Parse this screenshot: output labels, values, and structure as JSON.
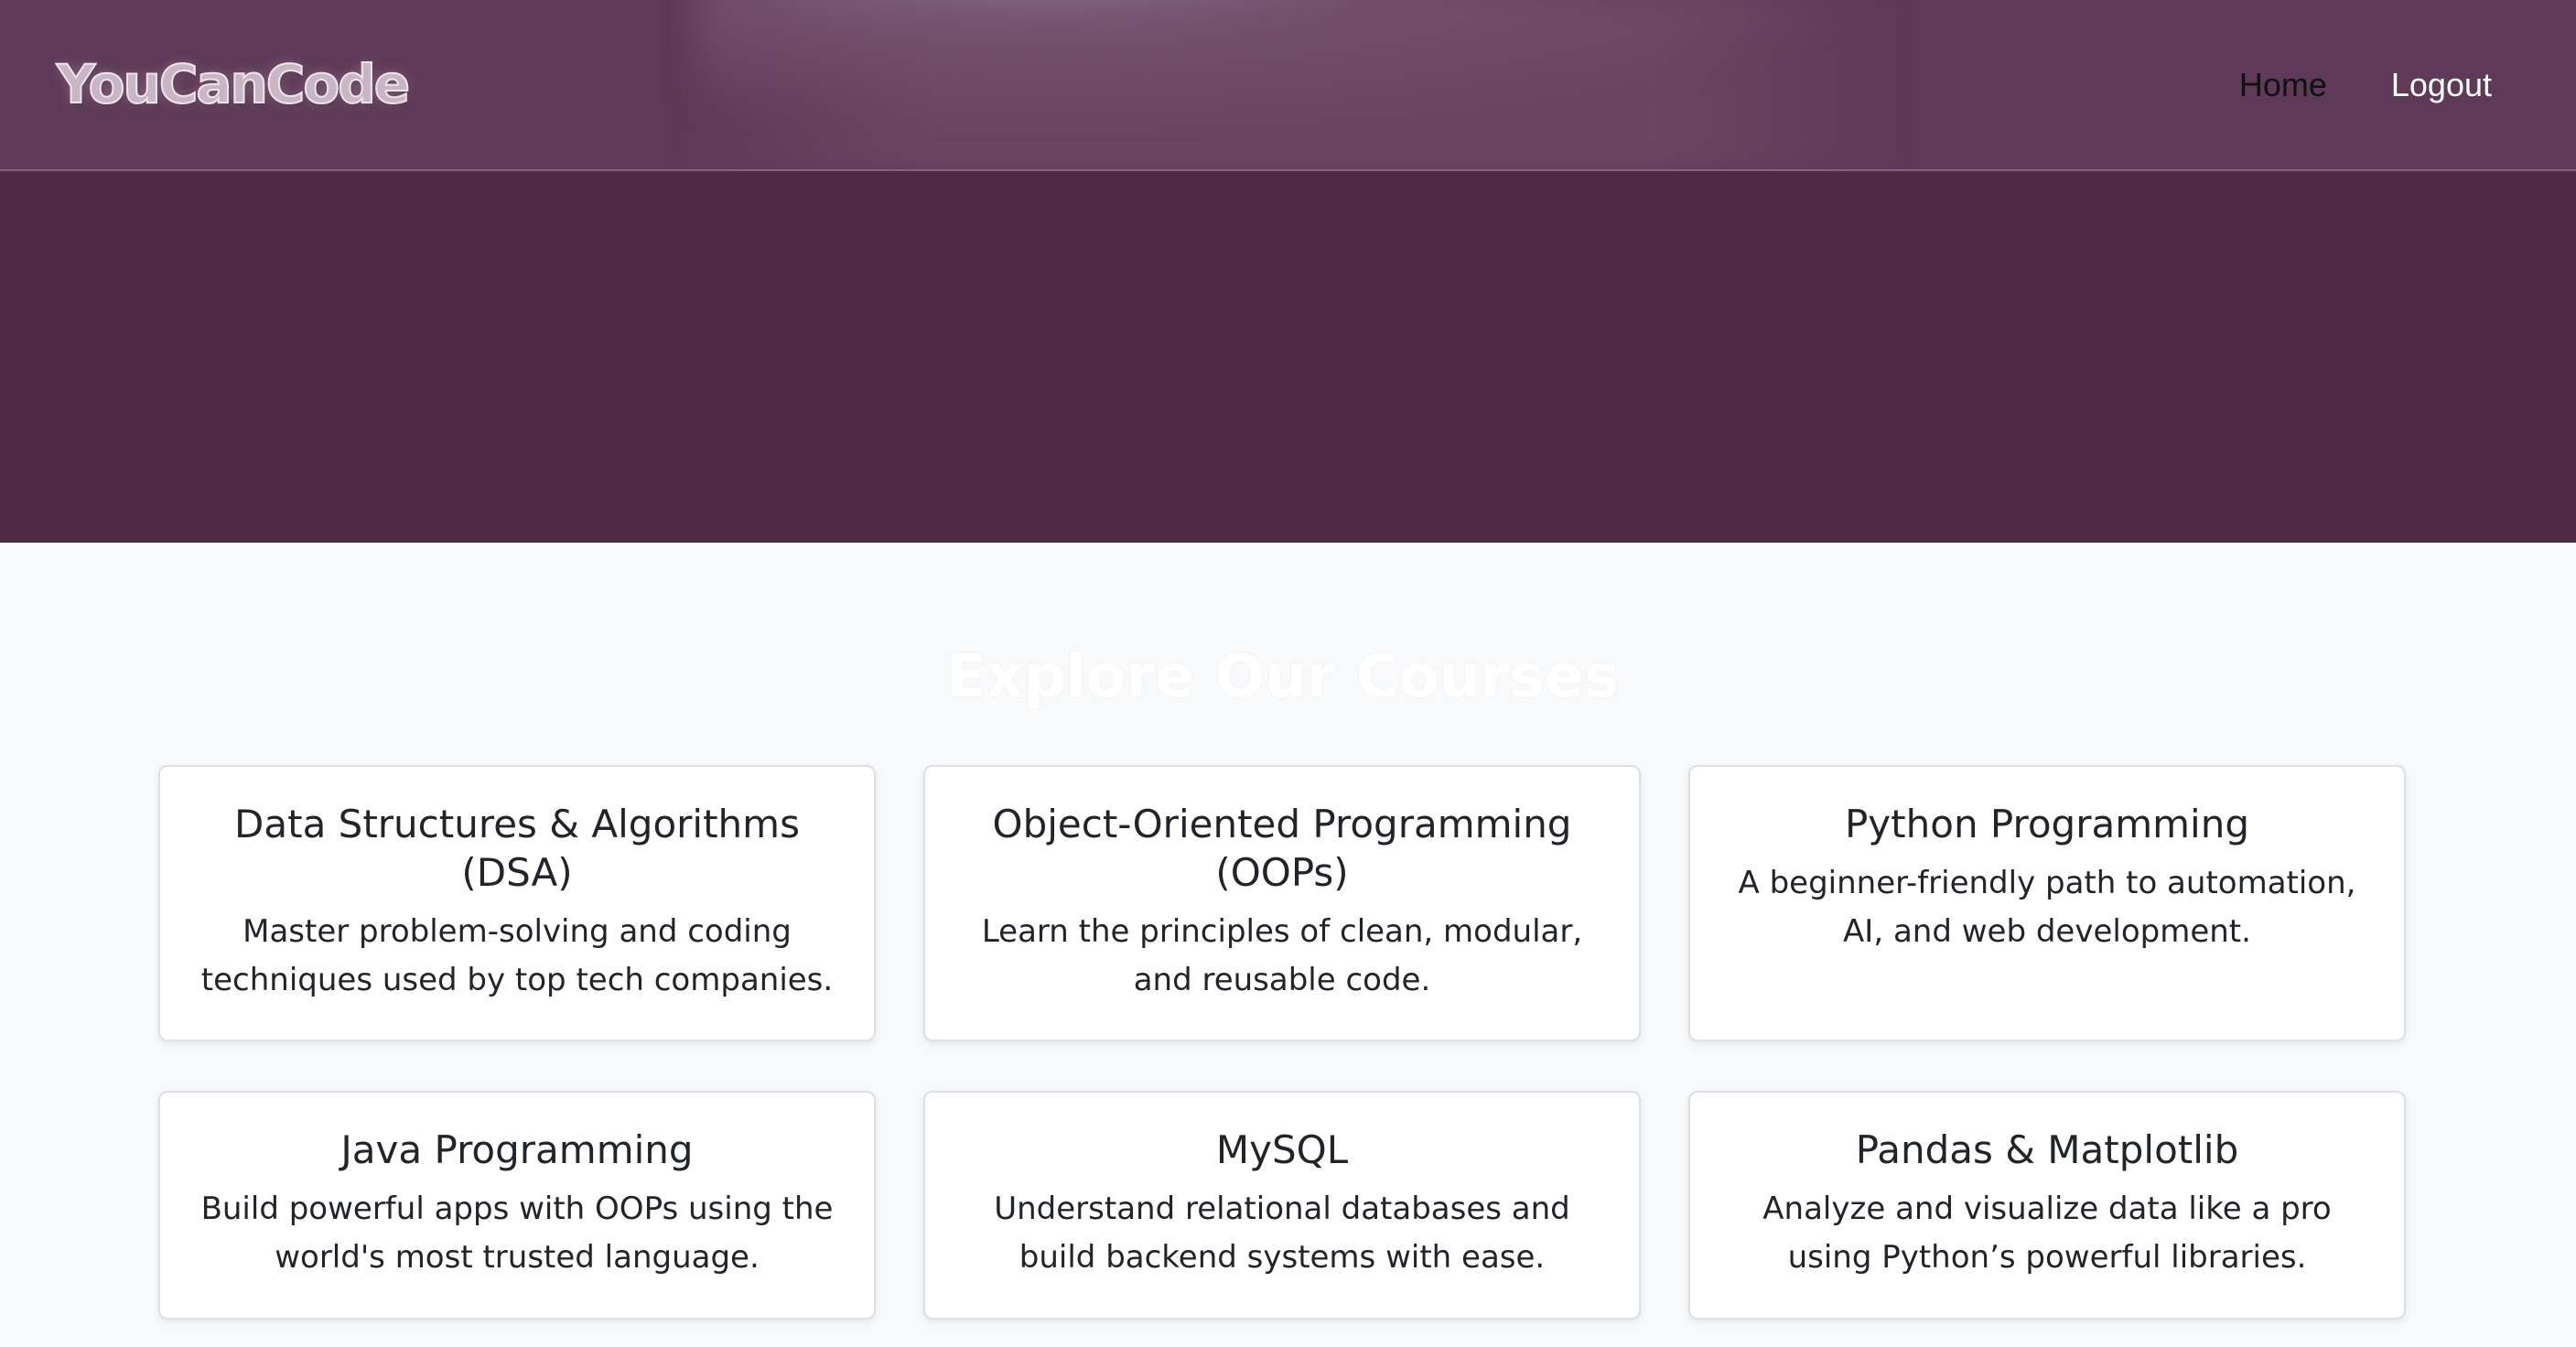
{
  "brand": {
    "name": "YouCanCode"
  },
  "nav": {
    "home_label": "Home",
    "logout_label": "Logout"
  },
  "section": {
    "title": "Explore Our Courses"
  },
  "courses": [
    {
      "title": "Data Structures & Algorithms (DSA)",
      "description": "Master problem-solving and coding techniques used by top tech companies."
    },
    {
      "title": "Object-Oriented Programming (OOPs)",
      "description": "Learn the principles of clean, modular, and reusable code."
    },
    {
      "title": "Python Programming",
      "description": "A beginner-friendly path to automation, AI, and web development."
    },
    {
      "title": "Java Programming",
      "description": "Build powerful apps with OOPs using the world's most trusted language."
    },
    {
      "title": "MySQL",
      "description": "Understand relational databases and build backend systems with ease."
    },
    {
      "title": "Pandas & Matplotlib",
      "description": "Analyze and visualize data like a pro using Python’s powerful libraries."
    }
  ],
  "colors": {
    "hero_bg": "#4e2a45",
    "navbar_bg": "#5f3958",
    "page_bg": "#f8f9fa",
    "card_bg": "#ffffff",
    "text_dark": "#212529"
  }
}
